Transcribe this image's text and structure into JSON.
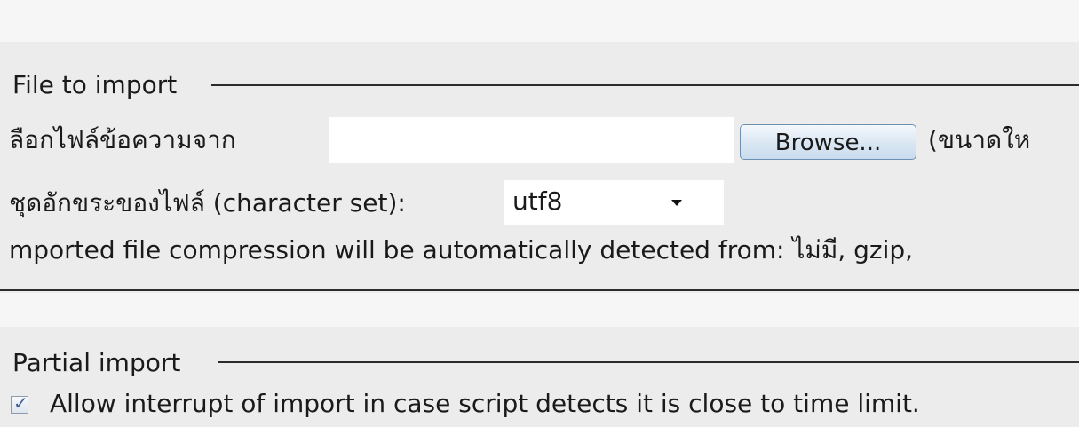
{
  "file_to_import": {
    "legend": "File to import",
    "browse_label": "ลือกไฟล์ข้อความจาก",
    "file_value": "",
    "browse_button": "Browse...",
    "size_note": "(ขนาดให",
    "charset_label": "ชุดอักขระของไฟล์ (character set):",
    "charset_value": "utf8",
    "compression_note": "mported file compression will be automatically detected from: ไม่มี, gzip,"
  },
  "partial_import": {
    "legend": "Partial import",
    "allow_interrupt_checked": true,
    "allow_interrupt_label": "Allow interrupt of import in case script detects it is close to time limit."
  },
  "icons": {
    "select_arrow": "chevron-down-icon",
    "checkbox_mark": "checkmark-icon"
  }
}
